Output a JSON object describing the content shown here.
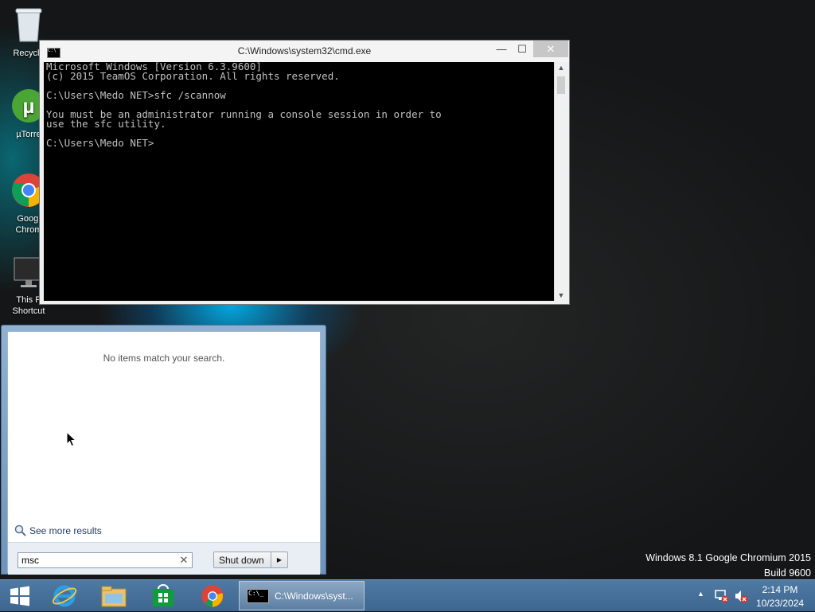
{
  "desktop": {
    "icons": [
      {
        "label": "Recycle",
        "icon": "recycle-bin-icon"
      },
      {
        "label": "µTorre",
        "icon": "utorrent-icon"
      },
      {
        "label": "Googl Chrom",
        "icon": "chrome-icon"
      },
      {
        "label": "This P Shortcut",
        "icon": "monitor-icon"
      }
    ]
  },
  "cmd_window": {
    "title": "C:\\Windows\\system32\\cmd.exe",
    "minimize": "—",
    "maximize": "☐",
    "close": "✕",
    "console_text": "Microsoft Windows [Version 6.3.9600]\n(c) 2015 TeamOS Corporation. All rights reserved.\n\nC:\\Users\\Medo NET>sfc /scannow\n\nYou must be an administrator running a console session in order to\nuse the sfc utility.\n\nC:\\Users\\Medo NET>"
  },
  "start_menu": {
    "no_items": "No items match your search.",
    "see_more": "See more results",
    "search_value": "msc",
    "clear": "✕",
    "shutdown_label": "Shut down",
    "shutdown_arrow": "▶"
  },
  "taskbar": {
    "pinned": [
      "start-icon",
      "internet-explorer-icon",
      "file-explorer-icon",
      "store-icon",
      "chrome-icon"
    ],
    "active_window": "C:\\Windows\\syst...",
    "time": "2:14 PM",
    "date": "10/23/2024",
    "tray_arrow": "▲"
  },
  "watermark": {
    "line1": "Windows 8.1 Google Chromium 2015",
    "line2": "Build 9600"
  }
}
